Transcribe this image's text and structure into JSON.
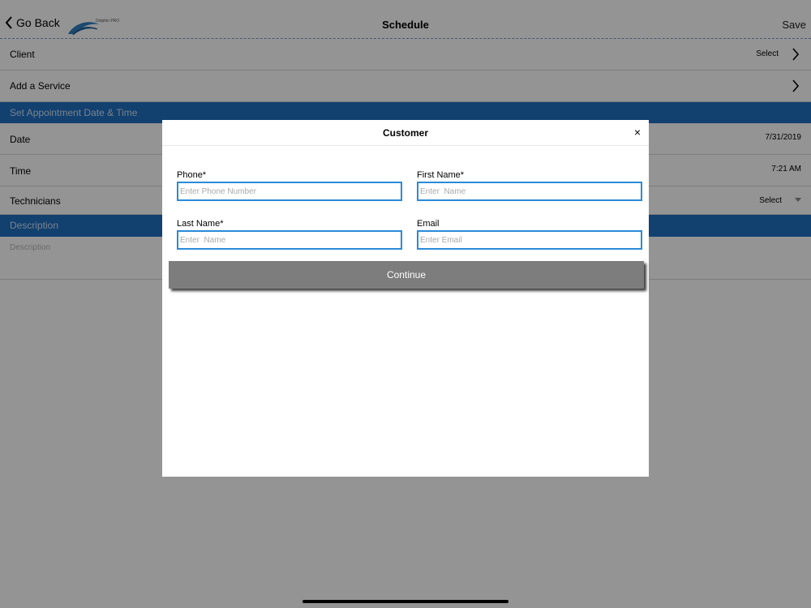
{
  "header": {
    "back_label": "Go Back",
    "logo_text": "Dolphin PRO",
    "title": "Schedule",
    "save_label": "Save"
  },
  "rows": {
    "client": {
      "label": "Client",
      "value": "Select"
    },
    "service": {
      "label": "Add a Service"
    },
    "date": {
      "label": "Date",
      "value": "7/31/2019"
    },
    "time": {
      "label": "Time",
      "value": "7:21 AM"
    },
    "technicians": {
      "label": "Technicians",
      "value": "Select"
    }
  },
  "sections": {
    "appointment": "Set Appointment Date & Time",
    "description": "Description"
  },
  "description_placeholder": "Description",
  "modal": {
    "title": "Customer",
    "close_label": "×",
    "fields": {
      "phone": {
        "label": "Phone*",
        "placeholder": "Enter Phone Number"
      },
      "first_name": {
        "label": "First Name*",
        "placeholder": "Enter  Name"
      },
      "last_name": {
        "label": "Last Name*",
        "placeholder": "Enter  Name"
      },
      "email": {
        "label": "Email",
        "placeholder": "Enter Email"
      }
    },
    "continue_label": "Continue"
  },
  "colors": {
    "accent": "#1f6fbf",
    "input_border": "#2a8ad9",
    "button": "#7d7d7d"
  }
}
